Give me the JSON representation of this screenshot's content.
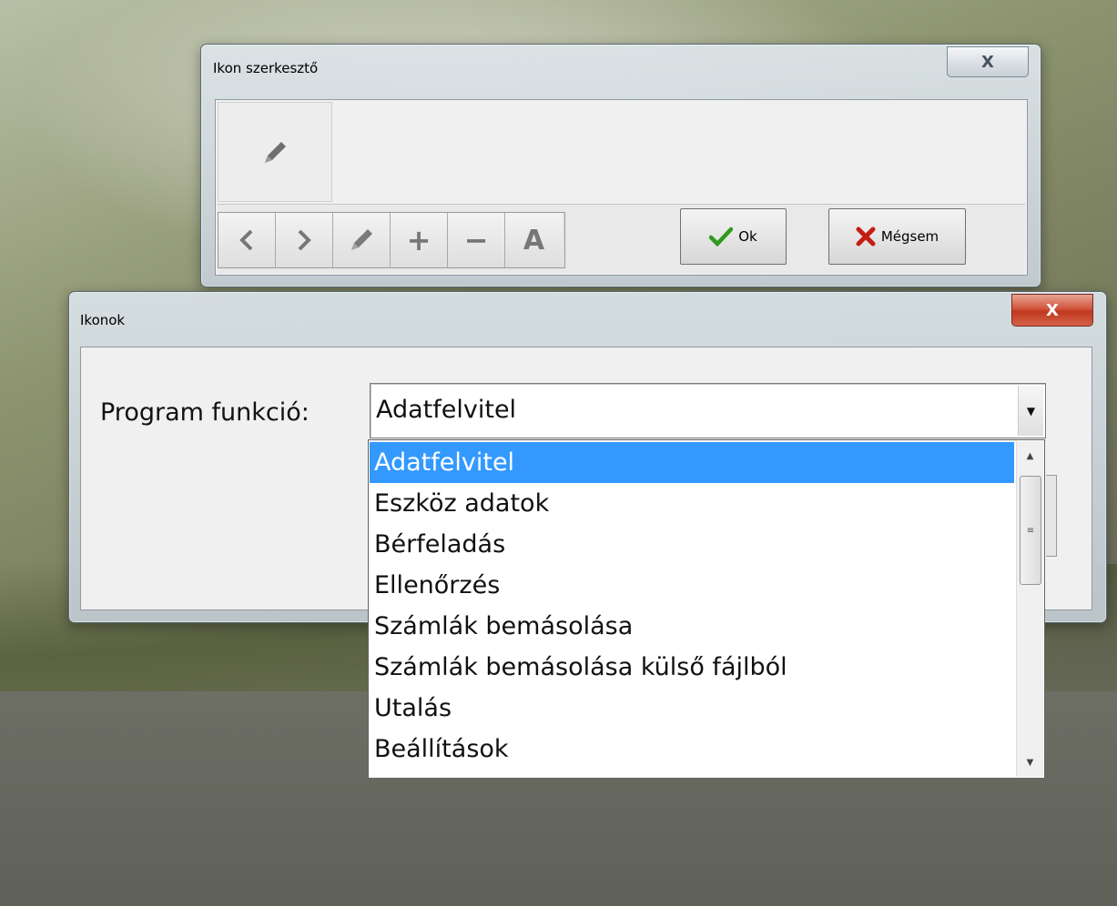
{
  "icon_editor": {
    "title": "Ikon szerkesztő",
    "close_glyph": "X",
    "current_icon": "pencil-icon",
    "toolbar": {
      "prev": "‹",
      "next": "›",
      "add": "+",
      "remove": "−",
      "text": "A"
    },
    "ok_label": "Ok",
    "cancel_label": "Mégsem"
  },
  "icons_dialog": {
    "title": "Ikonok",
    "close_glyph": "X",
    "field_label": "Program funkció:",
    "selected_value": "Adatfelvitel",
    "options": [
      "Adatfelvitel",
      "Eszköz adatok",
      "Bérfeladás",
      "Ellenőrzés",
      "Számlák bemásolása",
      "Számlák bemásolása külső fájlból",
      "Utalás",
      "Beállítások"
    ],
    "selected_index": 0
  },
  "colors": {
    "selection": "#3399ff",
    "ok_check": "#2e9a1a",
    "cancel_x": "#c41d12",
    "close_red": "#c0391f"
  }
}
